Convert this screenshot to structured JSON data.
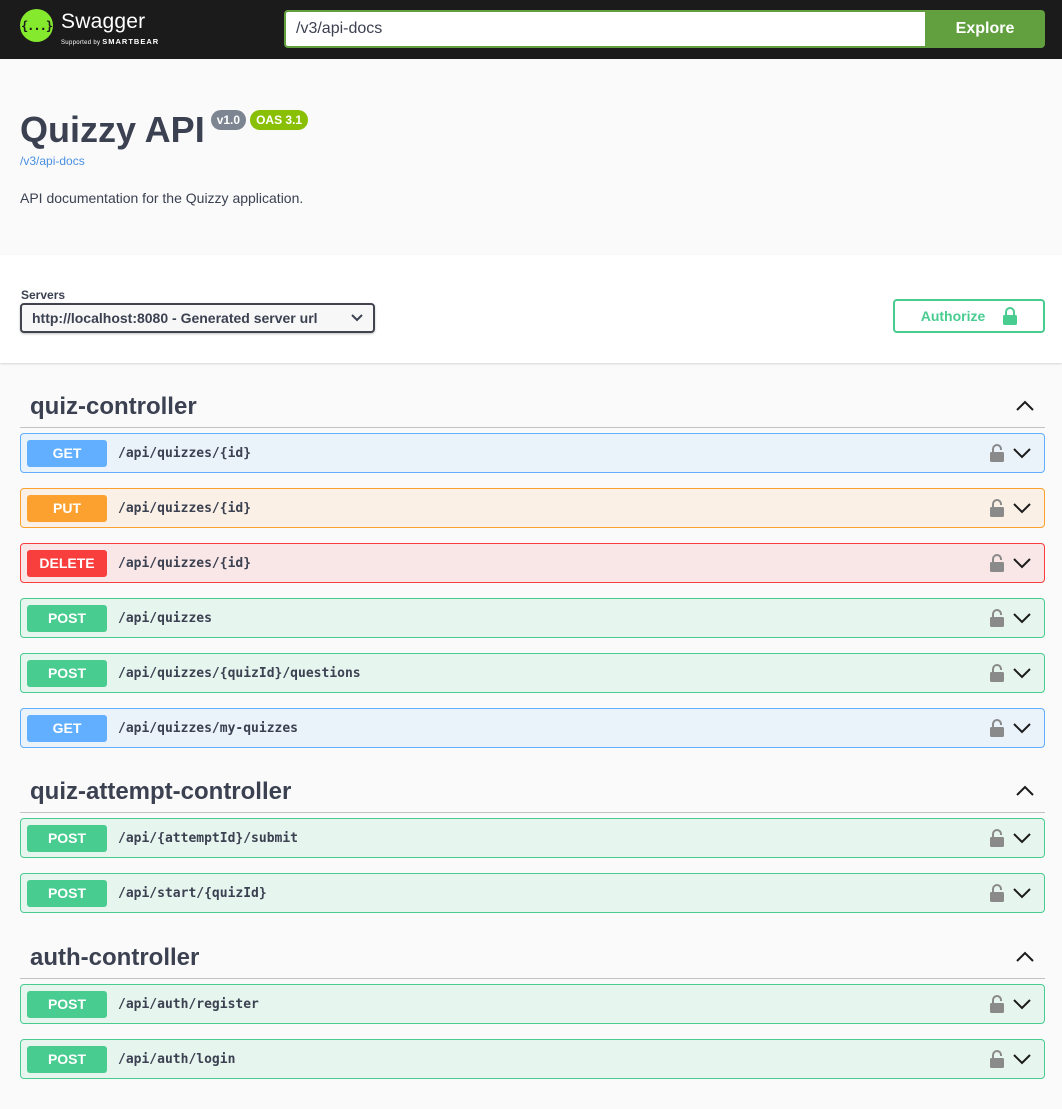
{
  "topbar": {
    "logo_icon": "{...}",
    "logo_word": "Swagger",
    "logo_sub_prefix": "Supported by",
    "logo_sub_brand": "SMARTBEAR",
    "url_value": "/v3/api-docs",
    "explore_label": "Explore"
  },
  "info": {
    "title": "Quizzy API",
    "version": "v1.0",
    "oas": "OAS 3.1",
    "spec_link": "/v3/api-docs",
    "description": "API documentation for the Quizzy application."
  },
  "servers": {
    "label": "Servers",
    "selected": "http://localhost:8080 - Generated server url"
  },
  "authorize_label": "Authorize",
  "colors": {
    "get": "#61affe",
    "put": "#fca130",
    "delete": "#f93e3e",
    "post": "#49cc90",
    "explore": "#62a03f"
  },
  "tags": [
    {
      "name": "quiz-controller",
      "ops": [
        {
          "method": "GET",
          "path": "/api/quizzes/{id}"
        },
        {
          "method": "PUT",
          "path": "/api/quizzes/{id}"
        },
        {
          "method": "DELETE",
          "path": "/api/quizzes/{id}"
        },
        {
          "method": "POST",
          "path": "/api/quizzes"
        },
        {
          "method": "POST",
          "path": "/api/quizzes/{quizId}/questions"
        },
        {
          "method": "GET",
          "path": "/api/quizzes/my-quizzes"
        }
      ]
    },
    {
      "name": "quiz-attempt-controller",
      "ops": [
        {
          "method": "POST",
          "path": "/api/{attemptId}/submit"
        },
        {
          "method": "POST",
          "path": "/api/start/{quizId}"
        }
      ]
    },
    {
      "name": "auth-controller",
      "ops": [
        {
          "method": "POST",
          "path": "/api/auth/register"
        },
        {
          "method": "POST",
          "path": "/api/auth/login"
        }
      ]
    }
  ]
}
